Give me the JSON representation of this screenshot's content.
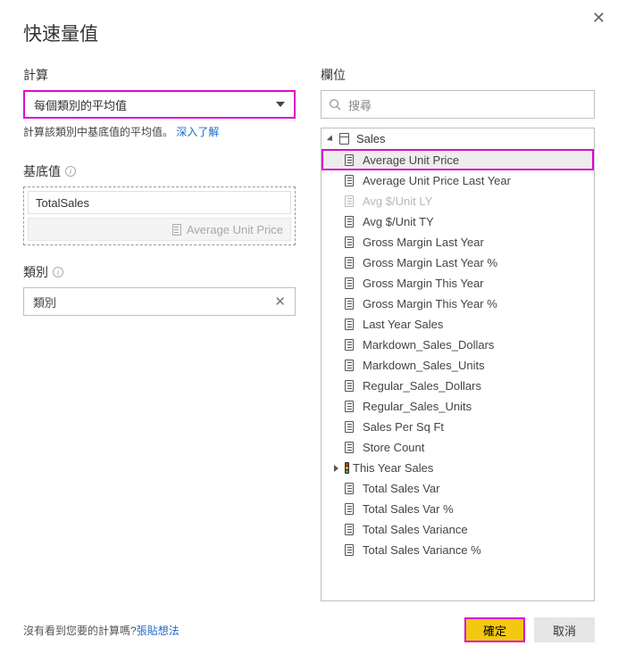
{
  "title": "快速量值",
  "close_icon_glyph": "✕",
  "left": {
    "calc_label": "計算",
    "calc_value": "每個類別的平均值",
    "help_text_prefix": "計算該類別中基底值的平均值。 ",
    "help_link": "深入了解",
    "base_label": "基底值",
    "base_chip_primary": "TotalSales",
    "base_chip_drag": "Average Unit Price",
    "category_label": "類別",
    "category_value": "類別"
  },
  "right": {
    "section_label": "欄位",
    "search_placeholder": "搜尋",
    "table_name": "Sales",
    "fields": [
      {
        "label": "Average Unit Price",
        "type": "measure",
        "highlighted": true
      },
      {
        "label": "Average Unit Price Last Year",
        "type": "measure"
      },
      {
        "label": "Avg $/Unit LY",
        "type": "measure",
        "dimmed": true
      },
      {
        "label": "Avg $/Unit TY",
        "type": "measure"
      },
      {
        "label": "Gross Margin Last Year",
        "type": "measure"
      },
      {
        "label": "Gross Margin Last Year %",
        "type": "measure"
      },
      {
        "label": "Gross Margin This Year",
        "type": "measure"
      },
      {
        "label": "Gross Margin This Year %",
        "type": "measure"
      },
      {
        "label": "Last Year Sales",
        "type": "measure"
      },
      {
        "label": "Markdown_Sales_Dollars",
        "type": "measure"
      },
      {
        "label": "Markdown_Sales_Units",
        "type": "measure"
      },
      {
        "label": "Regular_Sales_Dollars",
        "type": "measure"
      },
      {
        "label": "Regular_Sales_Units",
        "type": "measure"
      },
      {
        "label": "Sales Per Sq Ft",
        "type": "measure"
      },
      {
        "label": "Store Count",
        "type": "measure"
      },
      {
        "label": "This Year Sales",
        "type": "kpi",
        "expandable": true
      },
      {
        "label": "Total Sales Var",
        "type": "measure"
      },
      {
        "label": "Total Sales Var %",
        "type": "measure"
      },
      {
        "label": "Total Sales Variance",
        "type": "measure"
      },
      {
        "label": "Total Sales Variance %",
        "type": "measure"
      }
    ]
  },
  "footer": {
    "question_prefix": "沒有看到您要的計算嗎?",
    "question_link": "張貼想法",
    "ok": "確定",
    "cancel": "取消"
  }
}
